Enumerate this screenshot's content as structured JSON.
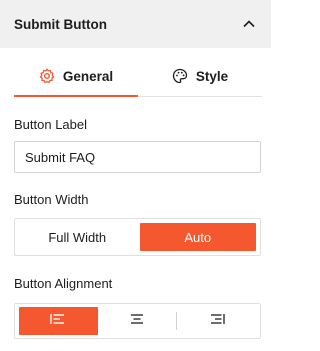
{
  "panel": {
    "title": "Submit Button",
    "collapse_icon": "chevron-up-icon"
  },
  "tabs": [
    {
      "label": "General",
      "icon": "gear-icon",
      "active": true
    },
    {
      "label": "Style",
      "icon": "palette-icon",
      "active": false
    }
  ],
  "button_label": {
    "label": "Button Label",
    "value": "Submit FAQ"
  },
  "button_width": {
    "label": "Button Width",
    "options": [
      "Full Width",
      "Auto"
    ],
    "selected": "Auto"
  },
  "button_alignment": {
    "label": "Button Alignment",
    "options": [
      "align-left-icon",
      "align-center-icon",
      "align-right-icon"
    ],
    "selected": "align-left-icon"
  },
  "colors": {
    "accent": "#f5582f",
    "header_bg": "#f0f0f0"
  }
}
